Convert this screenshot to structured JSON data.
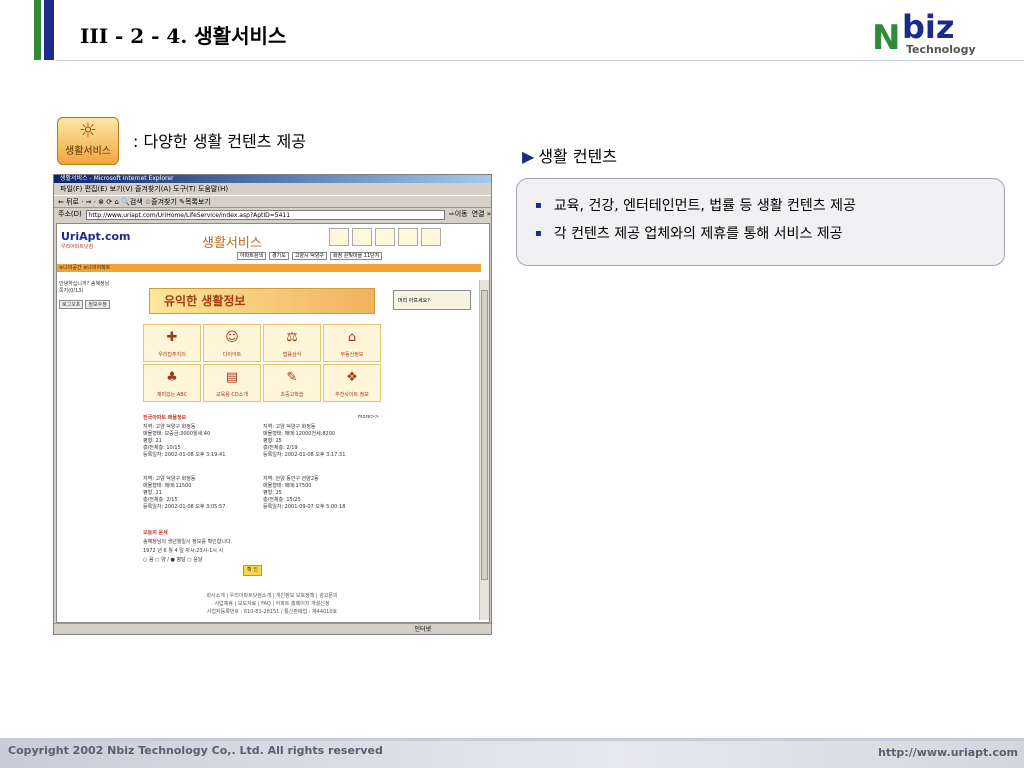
{
  "slide": {
    "title": "III - 2 - 4. 생활서비스",
    "logo": {
      "mark": "N",
      "name": "biz",
      "sub": "Technology"
    },
    "icon_label": "생활서비스",
    "caption": ": 다양한 생활 컨텐츠 제공",
    "section_heading": "생활 컨텐츠",
    "bullets": [
      "교육, 건강, 엔터테인먼트, 법률 등 생활 컨텐츠 제공",
      "각 컨텐츠 제공 업체와의 제휴를 통해 서비스 제공"
    ],
    "copyright": "Copyright 2002 Nbiz Technology Co,. Ltd. All rights reserved",
    "website": "http://www.uriapt.com"
  },
  "browser": {
    "title": "생활서비스 - Microsoft Internet Explorer",
    "menu": "파일(F)  편집(E)  보기(V)  즐겨찾기(A)  도구(T)  도움말(H)",
    "toolbar": "⇐ 뒤로 · ⇒ · ⊗ ⟳ ⌂  🔍검색  ☆즐겨찾기  ✎목록보기",
    "address_label": "주소(D)",
    "url": "http://www.uriapt.com/UriHome/LifeService/index.asp?AptID=5411",
    "go_label": "⇨이동",
    "links_label": "연결 »",
    "status_left": "",
    "status_zone": "인터넷"
  },
  "site": {
    "logo": "UriApt.com",
    "logo_sub": "우리아파트닷컴",
    "page_title": "생활서비스",
    "search_btn": "아파트검색",
    "search_fields": [
      "경기도",
      "고양시 덕양구",
      "화정 은빛마을 11단지"
    ],
    "nav": "≡나의공간  ≡나의아파트",
    "greeting": "안녕하십니까? 송혜정님",
    "mail": "쪽지(0/13)",
    "btn_logout": "로그오프",
    "btn_edit": "정보수정",
    "banner": "유익한 생활정보",
    "side_ad": "머리 아프세요?",
    "services": [
      {
        "icon": "✚",
        "label": "우리집주치의"
      },
      {
        "icon": "☺",
        "label": "다이어트"
      },
      {
        "icon": "⚖",
        "label": "법률상식"
      },
      {
        "icon": "⌂",
        "label": "부동산정보"
      },
      {
        "icon": "♣",
        "label": "재미있는 ABC"
      },
      {
        "icon": "▤",
        "label": "교육용 CD소개"
      },
      {
        "icon": "✎",
        "label": "초중고학습"
      },
      {
        "icon": "❖",
        "label": "추천사이트 정보"
      }
    ],
    "apt_heading": "전국아파트 매물정보",
    "apt_more": "more>>",
    "listings": [
      [
        "지역: 고양 덕양구 화정동",
        "매물형태: 보증금:3000월세:40",
        "평형: 21",
        "층/전체층: 10/15",
        "등록일자: 2002-01-08 오후 3:19:41"
      ],
      [
        "지역: 고양 덕양구 화정동",
        "매물형태: 매매:12000천세:8200",
        "평형: 25",
        "층/전체층: 2/19",
        "등록일자: 2002-01-08 오후 3:17:31"
      ],
      [
        "지역: 고양 덕양구 화정동",
        "매물형태: 매매:11500",
        "평형: 21",
        "층/전체층: 2/15",
        "등록일자: 2002-01-08 오후 3:05:57"
      ],
      [
        "지역: 안양 동안구 관양2동",
        "매물형태: 매매:17500",
        "평형: 25",
        "층/전체층: 15/25",
        "등록일자: 2001-09-07 오후 5:00:18"
      ]
    ],
    "fortune_heading": "오늘의 운세",
    "fortune_text": "송혜정님의 생년월일시 정보를 확인합니다.",
    "fortune_inputs": "1972 년  6 월  4 일   자시:23시-1시  시",
    "fortune_calendar": "○ 음 ○ 양 /  ● 평달 ○ 윤달",
    "fortune_ok": "확 인",
    "footer_links": "회사소개 | 우리아파트닷컴소개 | 개인정보 보호정책 | 광고문의",
    "footer_links2": "사업제휴 | 보도자료 | FAQ | 아파트 홈페이지 개설신청",
    "footer_biz": "사업자등록번호 : 610-81-28151 / 통신판매업 : 제44010호"
  }
}
